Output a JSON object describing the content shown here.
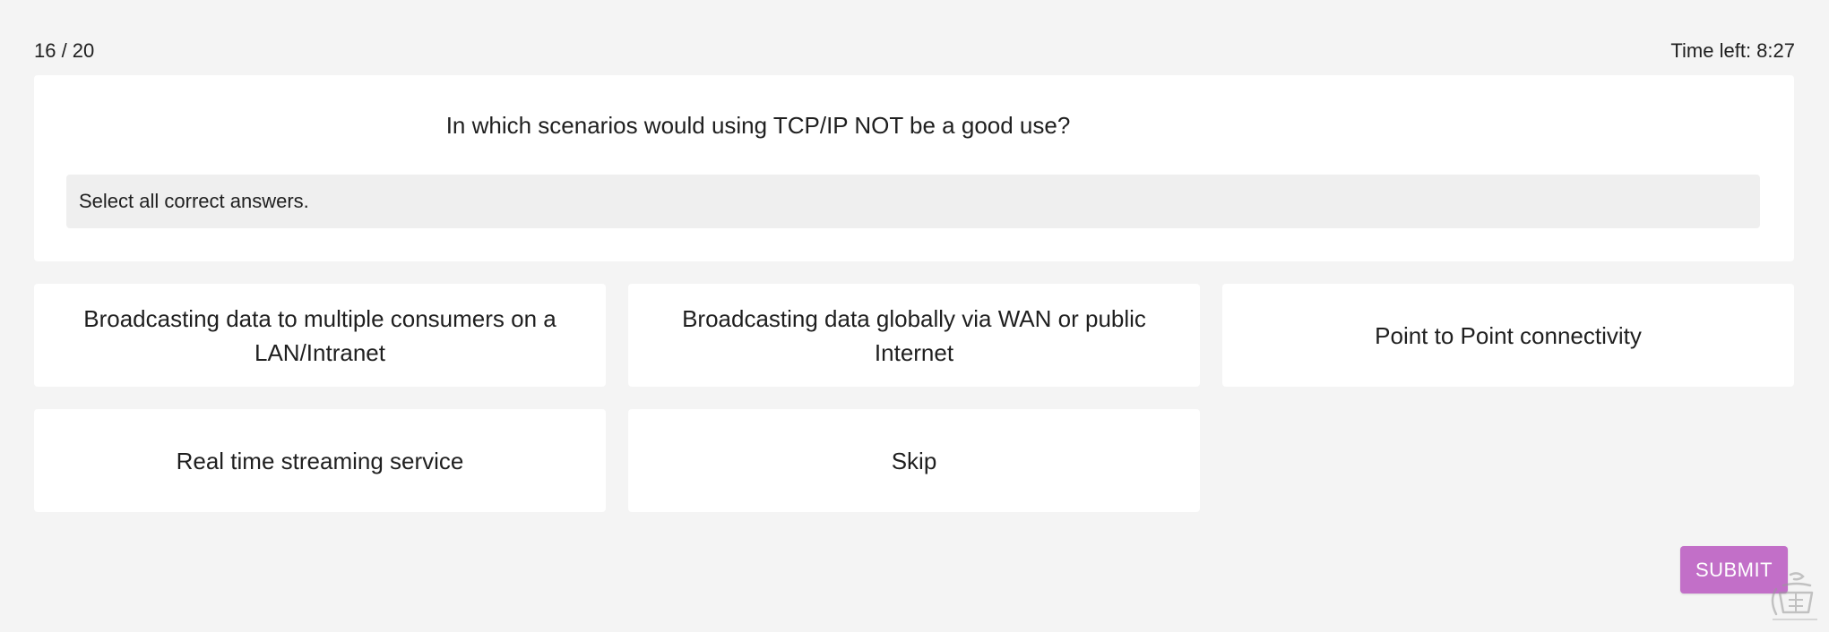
{
  "header": {
    "progress": "16 / 20",
    "timer": "Time left: 8:27"
  },
  "question": {
    "text": "In which scenarios would using TCP/IP NOT be a good use?",
    "hint": "Select all correct answers."
  },
  "options": [
    {
      "label": "Broadcasting data to multiple consumers on a LAN/Intranet"
    },
    {
      "label": "Broadcasting data globally via WAN or public Internet"
    },
    {
      "label": "Point to Point connectivity"
    },
    {
      "label": "Real time streaming service"
    },
    {
      "label": "Skip"
    }
  ],
  "actions": {
    "submit_label": "SUBMIT"
  },
  "colors": {
    "background": "#f4f4f4",
    "card": "#ffffff",
    "hint_bg": "#efefef",
    "submit": "#c26fc8"
  },
  "watermark": {
    "icon": "stamp-logo-icon"
  }
}
